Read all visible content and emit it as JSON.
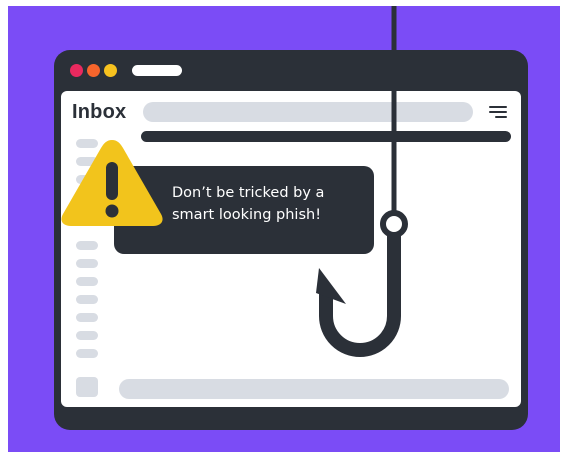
{
  "app": {
    "window_dots": [
      {
        "name": "close",
        "color": "#e9295f"
      },
      {
        "name": "minimize",
        "color": "#f7652c"
      },
      {
        "name": "maximize",
        "color": "#f7c21f"
      }
    ]
  },
  "inbox": {
    "title": "Inbox"
  },
  "alert": {
    "message_line1": "Don’t be tricked by a",
    "message_line2": "smart looking phish!",
    "icon": "warning-triangle-icon",
    "icon_color": "#f2c41c"
  },
  "illustration": {
    "icon": "fishing-hook-icon",
    "background_color": "#7b4cf6"
  }
}
